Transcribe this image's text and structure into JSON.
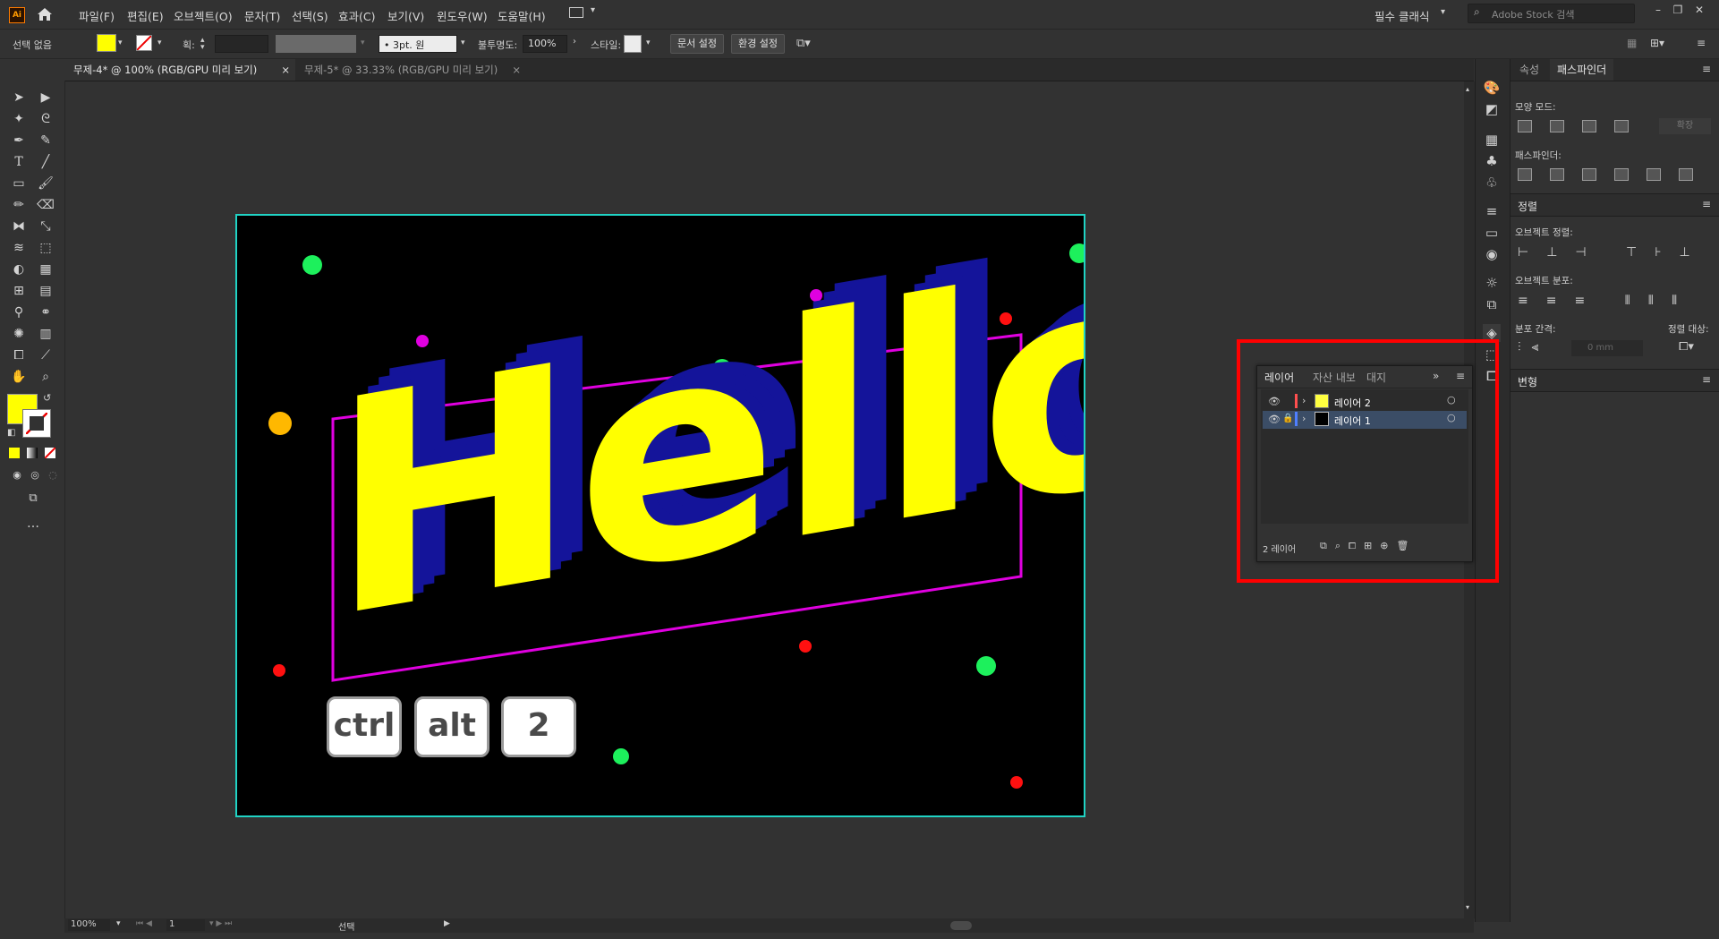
{
  "app": {
    "logo": "Ai"
  },
  "menu": [
    "파일(F)",
    "편집(E)",
    "오브젝트(O)",
    "문자(T)",
    "선택(S)",
    "효과(C)",
    "보기(V)",
    "윈도우(W)",
    "도움말(H)"
  ],
  "workspace": "필수 클래식",
  "stock_search_placeholder": "Adobe Stock 검색",
  "control": {
    "selection": "선택 없음",
    "stroke_label": "획:",
    "brush": "3pt. 원",
    "opacity_label": "불투명도:",
    "opacity": "100%",
    "style_label": "스타일:",
    "doc_setup": "문서 설정",
    "preferences": "환경 설정",
    "fill_color": "#ffff00"
  },
  "tabs": [
    {
      "label": "무제-4* @ 100% (RGB/GPU 미리 보기)",
      "active": true
    },
    {
      "label": "무제-5* @ 33.33% (RGB/GPU 미리 보기)",
      "active": false
    }
  ],
  "artwork": {
    "text": "Hello",
    "keys": [
      "ctrl",
      "alt",
      "2"
    ],
    "colors": {
      "text": "#ffff00",
      "extrude": "#14149a",
      "frame": "#e000e0",
      "artboard_border": "#20d3c4"
    }
  },
  "status": {
    "zoom": "100%",
    "page": "1",
    "tool": "선택"
  },
  "dock": {
    "tabs": [
      "속성",
      "패스파인더"
    ],
    "active_tab": "패스파인더",
    "shape_modes": "모양 모드:",
    "expand": "확장",
    "pathfinders": "패스파인더:",
    "align_title": "정렬",
    "align_objects": "오브젝트 정렬:",
    "distribute_objects": "오브젝트 분포:",
    "distribute_spacing": "분포 간격:",
    "align_to": "정렬 대상:",
    "spacing_value": "0 mm",
    "transform_title": "변형"
  },
  "layers_panel": {
    "tabs": [
      "레이어",
      "자산 내보",
      "대지"
    ],
    "layers": [
      {
        "name": "레이어 2",
        "color": "#ff4f4f",
        "locked": false,
        "selected": false
      },
      {
        "name": "레이어 1",
        "color": "#4f7fff",
        "locked": true,
        "selected": true
      }
    ],
    "count": "2 레이어"
  }
}
